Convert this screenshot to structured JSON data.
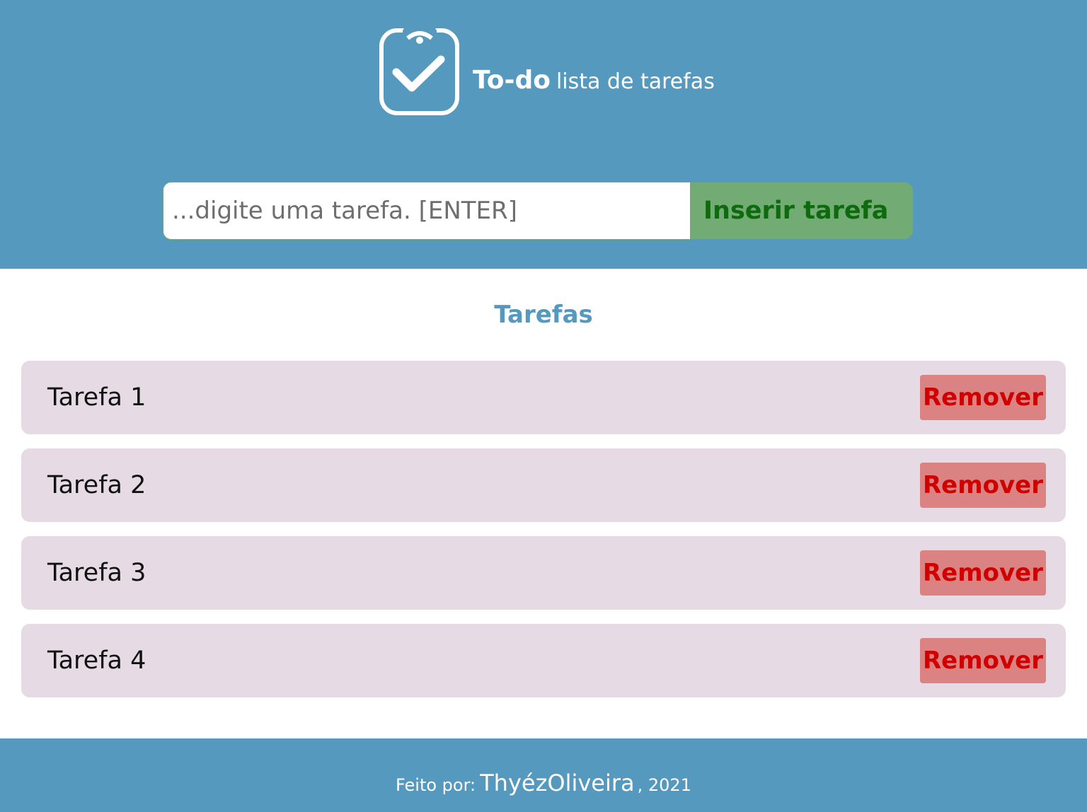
{
  "header": {
    "logo_icon": "clipboard-check-icon",
    "title_strong": "To-do",
    "title_light": "lista de tarefas"
  },
  "form": {
    "input_placeholder": "...digite uma tarefa. [ENTER]",
    "input_value": "",
    "submit_label": "Inserir tarefa"
  },
  "tasks": {
    "heading": "Tarefas",
    "items": [
      {
        "label": "Tarefa 1",
        "remove_label": "Remover"
      },
      {
        "label": "Tarefa 2",
        "remove_label": "Remover"
      },
      {
        "label": "Tarefa 3",
        "remove_label": "Remover"
      },
      {
        "label": "Tarefa 4",
        "remove_label": "Remover"
      }
    ]
  },
  "footer": {
    "prefix": "Feito por:",
    "author": "ThyézOliveira",
    "year": ", 2021"
  },
  "colors": {
    "header_bg": "#5699be",
    "task_bg": "#e6dbe4",
    "insert_bg": "#73ab75",
    "insert_text": "#0d6b0d",
    "remove_bg": "#db8383",
    "remove_text": "#d10000"
  }
}
